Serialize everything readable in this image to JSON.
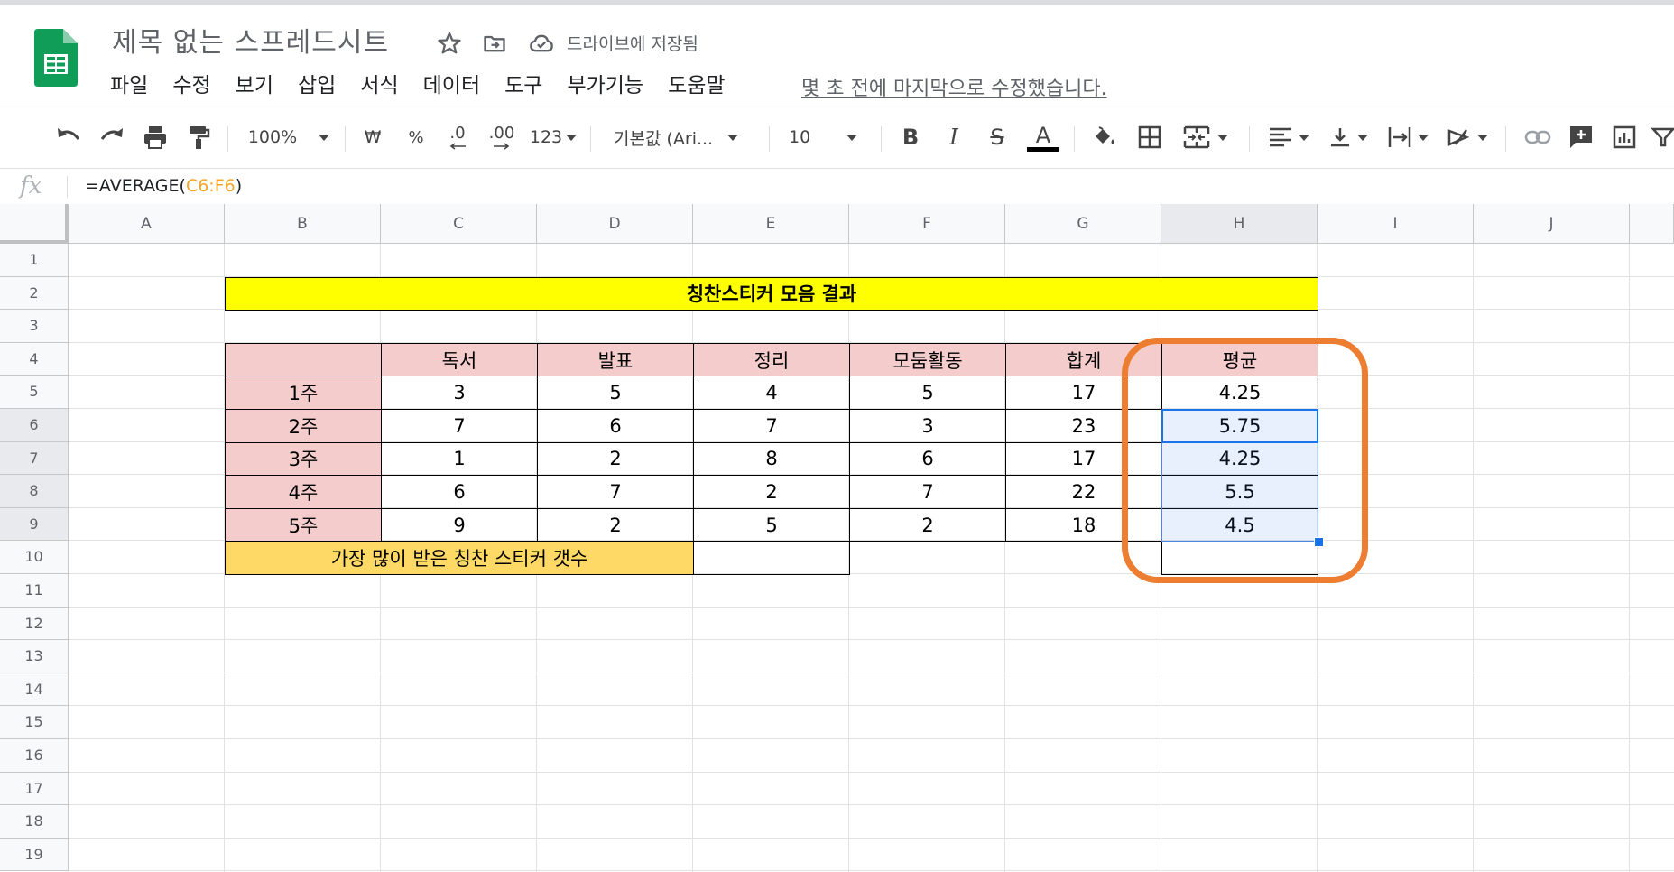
{
  "app": {
    "doc_title": "제목 없는 스프레드시트",
    "save_status": "드라이브에 저장됨",
    "last_edit": "몇 초 전에 마지막으로 수정했습니다.",
    "accent_color": "#0f9d58"
  },
  "menu": [
    "파일",
    "수정",
    "보기",
    "삽입",
    "서식",
    "데이터",
    "도구",
    "부가기능",
    "도움말"
  ],
  "toolbar": {
    "zoom": "100%",
    "currency": "₩",
    "percent": "%",
    "dec_decrease": ".0",
    "dec_increase": ".00",
    "number_format": "123",
    "font": "기본값 (Ari...",
    "font_size": "10",
    "bold": "B",
    "italic": "I",
    "strike": "S",
    "text_color": "A",
    "icons": [
      "undo-icon",
      "redo-icon",
      "print-icon",
      "paint-format-icon",
      "fill-color-icon",
      "borders-icon",
      "merge-icon",
      "align-icon",
      "valign-icon",
      "wrap-icon",
      "rotate-icon",
      "link-icon",
      "comment-icon",
      "chart-icon",
      "filter-icon"
    ]
  },
  "formula_bar": {
    "fx": "fx",
    "prefix": "=AVERAGE(",
    "range": "C6:F6",
    "suffix": ")"
  },
  "sheet": {
    "columns": [
      "A",
      "B",
      "C",
      "D",
      "E",
      "F",
      "G",
      "H",
      "I",
      "J"
    ],
    "rows": [
      "1",
      "2",
      "3",
      "4",
      "5",
      "6",
      "7",
      "8",
      "9",
      "10",
      "11",
      "12",
      "13",
      "14",
      "15",
      "16",
      "17",
      "18",
      "19"
    ],
    "selected_column": "H",
    "selected_rows": [
      "6",
      "7",
      "8",
      "9"
    ],
    "title": "칭찬스티커 모음 결과",
    "headers": [
      "독서",
      "발표",
      "정리",
      "모둠활동",
      "합계",
      "평균"
    ],
    "table": [
      {
        "label": "1주",
        "values": [
          "3",
          "5",
          "4",
          "5",
          "17",
          "4.25"
        ]
      },
      {
        "label": "2주",
        "values": [
          "7",
          "6",
          "7",
          "3",
          "23",
          "5.75"
        ]
      },
      {
        "label": "3주",
        "values": [
          "1",
          "2",
          "8",
          "6",
          "17",
          "4.25"
        ]
      },
      {
        "label": "4주",
        "values": [
          "6",
          "7",
          "2",
          "7",
          "22",
          "5.5"
        ]
      },
      {
        "label": "5주",
        "values": [
          "9",
          "2",
          "5",
          "2",
          "18",
          "4.5"
        ]
      }
    ],
    "footer_label": "가장 많이 받은 칭찬 스티커 갯수",
    "colors": {
      "header_fill": "#f4cccc",
      "title_fill": "#ffff00",
      "footer_fill": "#ffd966",
      "highlight": "#ed7d31"
    }
  }
}
